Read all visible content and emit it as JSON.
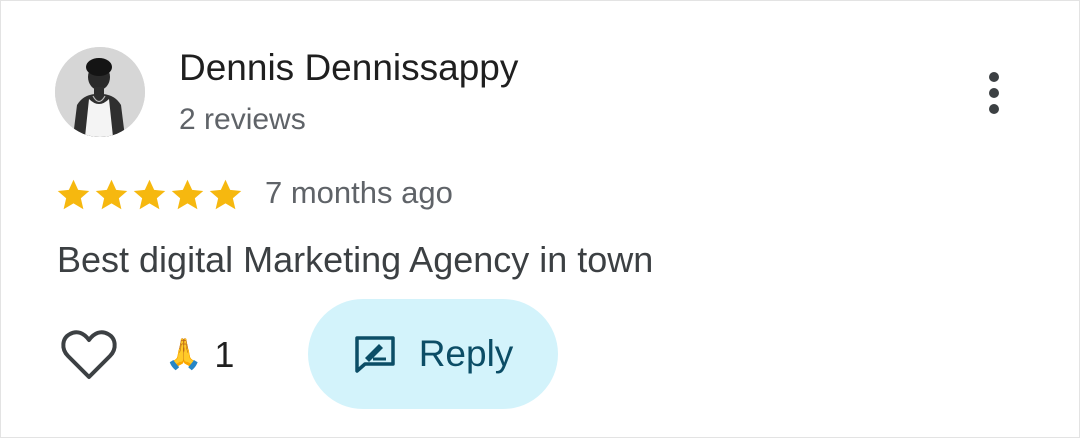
{
  "review": {
    "author": {
      "name": "Dennis Dennissappy",
      "reviews_label": "2 reviews",
      "avatar_icon": "profile-photo"
    },
    "rating": {
      "stars": 5,
      "max_stars": 5,
      "star_color": "#f6b80f"
    },
    "time_ago": "7 months ago",
    "text": "Best digital Marketing Agency in town",
    "actions": {
      "like_icon": "heart-outline-icon",
      "reaction_emoji": "🙏",
      "reaction_count": "1",
      "reply_label": "Reply",
      "reply_icon": "reply-message-icon",
      "reply_bg_color": "#d3f3fb",
      "reply_text_color": "#0b4d66"
    },
    "menu_icon": "more-vertical-icon"
  }
}
